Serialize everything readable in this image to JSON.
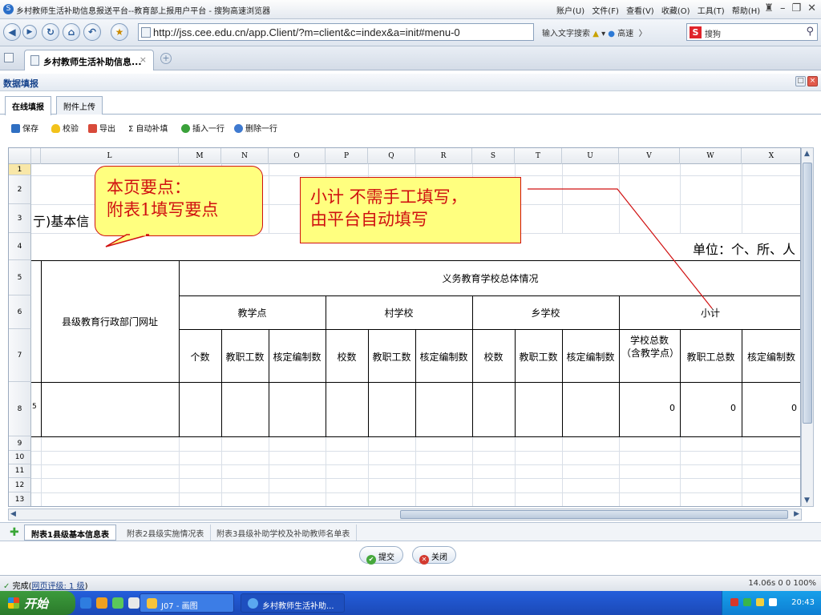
{
  "browser": {
    "window_title": "乡村教师生活补助信息报送平台--教育部上报用户平台 - 搜狗高速浏览器",
    "menu": [
      "账户(U)",
      "文件(F)",
      "查看(V)",
      "收藏(O)",
      "工具(T)",
      "帮助(H)"
    ],
    "url": "http://jss.cee.edu.cn/app.Client/?m=client&c=index&a=init#menu-0",
    "search_hint": "输入文字搜索",
    "speed_label": "高速",
    "search_engine": "搜狗",
    "tab_title": "乡村教师生活补助信息...",
    "accent": "#15428b"
  },
  "panel": {
    "title": "数据填报",
    "subtabs": [
      "在线填报",
      "附件上传"
    ]
  },
  "toolbar": {
    "buttons": [
      "保存",
      "校验",
      "导出",
      "自动补填",
      "插入一行",
      "删除一行"
    ]
  },
  "sheet": {
    "column_letters": [
      "L",
      "M",
      "N",
      "O",
      "P",
      "Q",
      "R",
      "S",
      "T",
      "U",
      "V",
      "W",
      "X"
    ],
    "row_numbers": [
      "1",
      "2",
      "3",
      "4",
      "5",
      "6",
      "7",
      "8",
      "9",
      "10",
      "11",
      "12",
      "13"
    ],
    "row3_text": ")基本信",
    "row3_prefix": "亍",
    "unit_text": "单位：个、所、人",
    "row8_fragment": "5",
    "left_header": "县级教育行政部门网址",
    "group_header": "义务教育学校总体情况",
    "subgroups": [
      "教学点",
      "村学校",
      "乡学校",
      "小计"
    ],
    "col_headers": [
      "个数",
      "教职工数",
      "核定编制数",
      "校数",
      "教职工数",
      "核定编制数",
      "校数",
      "教职工数",
      "核定编制数",
      "学校总数（含教学点）",
      "教职工总数",
      "核定编制数"
    ],
    "row8_values": [
      "0",
      "0",
      "0"
    ]
  },
  "sheet_tabs": [
    "附表1县级基本信息表",
    "附表2县级实施情况表",
    "附表3县级补助学校及补助教师名单表"
  ],
  "footer": {
    "submit": "提交",
    "close": "关闭"
  },
  "callouts": {
    "note1_line1": "本页要点：",
    "note1_line2": "附表1填写要点",
    "note2_line1": "小计  不需手工填写，",
    "note2_line2": "由平台自动填写"
  },
  "statusbar": {
    "left": "完成",
    "rating": "网页评级: 1 级",
    "right": "14.06s      0      0     100%"
  },
  "taskbar": {
    "start": "开始",
    "item1": "J07 - 画图",
    "item2": "乡村教师生活补助...",
    "clock": "20:43"
  }
}
